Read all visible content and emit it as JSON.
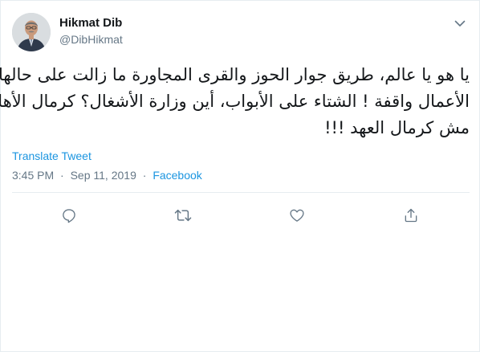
{
  "author": {
    "name": "Hikmat Dib",
    "handle": "@DibHikmat"
  },
  "icons": {
    "menu": "chevron-down-icon",
    "reply": "reply-icon",
    "retweet": "retweet-icon",
    "like": "heart-icon",
    "share": "share-icon"
  },
  "tweet": {
    "lines": [
      "يا هو يا عالم، طريق جوار الحوز والقرى المجاورة ما زالت على حالها",
      "الأعمال واقفة ! الشتاء على الأبواب، أين وزارة الأشغال؟ كرمال الأهالي",
      "مش كرمال العهد !!!"
    ],
    "translate_label": "Translate Tweet",
    "time": "3:45 PM",
    "date": "Sep 11, 2019",
    "separator": "·",
    "source": "Facebook"
  },
  "colors": {
    "link": "#1b95e0",
    "secondary_text": "#657786",
    "icon": "#657786",
    "border": "#e6ecf0"
  }
}
